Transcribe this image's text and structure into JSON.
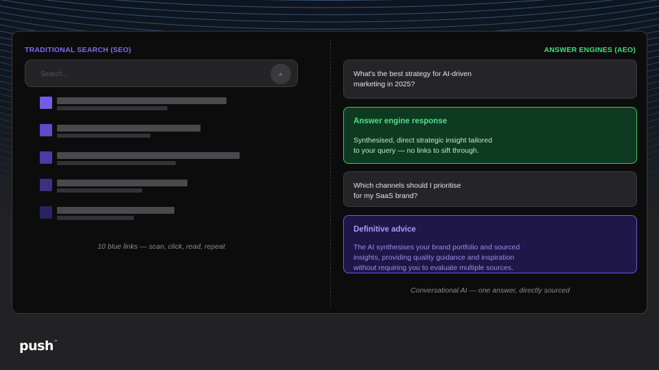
{
  "seo": {
    "label": "TRADITIONAL SEARCH (SEO)",
    "search_placeholder": "Search...",
    "search_icon": "search-icon",
    "results": [
      {
        "color": "#6f5de6"
      },
      {
        "color": "#5b4cc8"
      },
      {
        "color": "#4a3da8"
      },
      {
        "color": "#3a3084"
      },
      {
        "color": "#2a2560"
      }
    ],
    "caption": "10 blue links — scan, click, read, repeat"
  },
  "aeo": {
    "label": "ANSWER ENGINES (AEO)",
    "query1": "What's the best strategy for AI-driven\nmarketing in 2025?",
    "response": {
      "title": "Answer engine response",
      "body": "Synthesised, direct strategic insight tailored\nto your query — no links to sift through."
    },
    "query2": "Which channels should I prioritise\nfor my SaaS brand?",
    "advice": {
      "title": "Definitive advice",
      "body": "The AI synthesises your brand portfolio and sourced\ninsights, providing quality guidance and inspiration\nwithout requiring you to evaluate multiple sources."
    },
    "caption": "Conversational AI — one answer, directly sourced"
  },
  "brand": {
    "logo": "push",
    "mark": "™"
  },
  "colors": {
    "seo_accent": "#7c6cf0",
    "aeo_accent": "#3be07c"
  }
}
